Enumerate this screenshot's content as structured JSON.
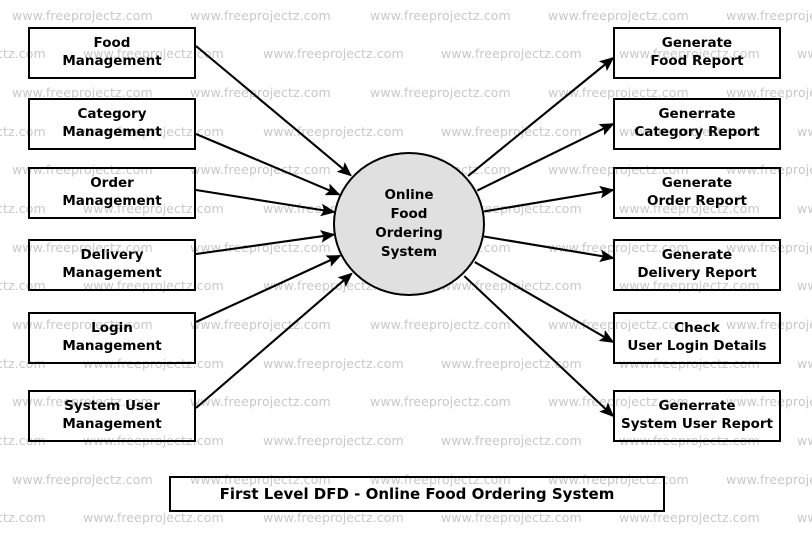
{
  "diagram": {
    "title": "First Level DFD - Online Food Ordering System",
    "process": {
      "name": "Online Food Ordering System",
      "label": "Online\nFood\nOrdering\nSystem",
      "fill_color": "#e0e0e0",
      "stroke_color": "#000000"
    },
    "inputs": [
      {
        "label": "Food\nManagement",
        "name": "food-management"
      },
      {
        "label": "Category\nManagement",
        "name": "category-management"
      },
      {
        "label": "Order\nManagement",
        "name": "order-management"
      },
      {
        "label": "Delivery\nManagement",
        "name": "delivery-management"
      },
      {
        "label": "Login\nManagement",
        "name": "login-management"
      },
      {
        "label": "System User\nManagement",
        "name": "system-user-management"
      }
    ],
    "outputs": [
      {
        "label": "Generate\nFood Report",
        "name": "generate-food-report"
      },
      {
        "label": "Generrate\nCategory Report",
        "name": "generate-category-report"
      },
      {
        "label": "Generate\nOrder Report",
        "name": "generate-order-report"
      },
      {
        "label": "Generate\nDelivery Report",
        "name": "generate-delivery-report"
      },
      {
        "label": "Check\nUser Login Details",
        "name": "check-user-login-details"
      },
      {
        "label": "Generrate\nSystem User Report",
        "name": "generate-system-user-report"
      }
    ]
  },
  "watermark": {
    "text": "www.freeprojectz.com",
    "color": "#c8c8c8"
  }
}
